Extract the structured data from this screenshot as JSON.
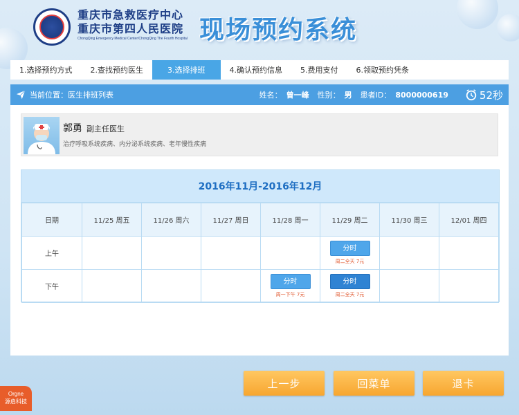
{
  "header": {
    "hospital_line1": "重庆市急救医疗中心",
    "hospital_line2": "重庆市第四人民医院",
    "hospital_en": "ChongQing Emergency Medical Center/ChongQing The Fourth Hospital",
    "system_title": "现场预约系统"
  },
  "steps": [
    {
      "label": "1.选择预约方式",
      "active": false
    },
    {
      "label": "2.查找预约医生",
      "active": false
    },
    {
      "label": "3.选择排班",
      "active": true
    },
    {
      "label": "4.确认预约信息",
      "active": false
    },
    {
      "label": "5.费用支付",
      "active": false
    },
    {
      "label": "6.领取预约凭条",
      "active": false
    }
  ],
  "infobar": {
    "location_label": "当前位置：",
    "location_value": "医生排班列表",
    "name_label": "姓名：",
    "name_value": "曾一峰",
    "gender_label": "性别：",
    "gender_value": "男",
    "id_label": "患者ID：",
    "id_value": "8000000619",
    "timer": "52秒"
  },
  "doctor": {
    "name": "郭勇",
    "title": "副主任医生",
    "specialty": "治疗呼吸系统疾病、内分泌系统疾病、老年慢性疾病"
  },
  "schedule": {
    "range_title": "2016年11月-2016年12月",
    "date_label": "日期",
    "columns": [
      "11/25 周五",
      "11/26 周六",
      "11/27 周日",
      "11/28 周一",
      "11/29 周二",
      "11/30 周三",
      "12/01 周四"
    ],
    "rows": [
      {
        "label": "上午",
        "cells": [
          null,
          null,
          null,
          null,
          {
            "button": "分时",
            "note": "周二全天 7元",
            "style": "normal"
          },
          null,
          null
        ]
      },
      {
        "label": "下午",
        "cells": [
          null,
          null,
          null,
          {
            "button": "分时",
            "note": "周一下午 7元",
            "style": "normal"
          },
          {
            "button": "分时",
            "note": "周二全天 7元",
            "style": "dark"
          },
          null,
          null
        ]
      }
    ]
  },
  "buttons": {
    "prev": "上一步",
    "menu": "回菜单",
    "exit": "退卡"
  },
  "brand": {
    "line1": "Orgne",
    "line2": "源启科技"
  },
  "colors": {
    "accent": "#4c9fe2",
    "button": "#f7a630",
    "note": "#e0552b"
  }
}
